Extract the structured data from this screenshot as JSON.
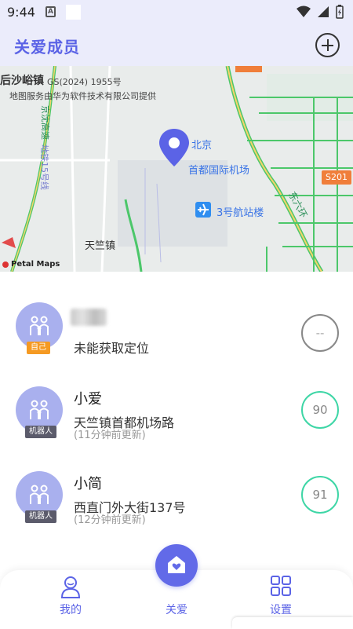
{
  "status_bar": {
    "time": "9:44",
    "notif_letter": "A"
  },
  "header": {
    "title": "关爱成员",
    "add_icon": "plus-circle-icon"
  },
  "map": {
    "label_town_top": "后沙峪镇",
    "approval": "GS(2024) 1955号",
    "provider": "地图服务由华为软件技术有限公司提供",
    "road_jingshun": "京沈高速",
    "road_shunbai": "机场北线",
    "place_line1": "北京",
    "place_line2": "首都国际机场",
    "terminal": "3号航站楼",
    "town_bottom": "天竺镇",
    "road_s201": "S201",
    "ring_label": "东六环",
    "rail_label": "地铁15号线",
    "petal": "Petal Maps"
  },
  "members": [
    {
      "name": "",
      "tag": "自己",
      "location": "未能获取定位",
      "updated": "",
      "score": "--"
    },
    {
      "name": "小爱",
      "tag": "机器人",
      "location": "天竺镇首都机场路",
      "updated": "(11分钟前更新)",
      "score": "90"
    },
    {
      "name": "小简",
      "tag": "机器人",
      "location": "西直门外大街137号",
      "updated": "(12分钟前更新)",
      "score": "91"
    }
  ],
  "nav": {
    "mine": "我的",
    "care": "关爱",
    "settings": "设置"
  },
  "colors": {
    "accent": "#5b63e6",
    "score_ring": "#3ed6a6",
    "self_tag": "#f59a23"
  }
}
